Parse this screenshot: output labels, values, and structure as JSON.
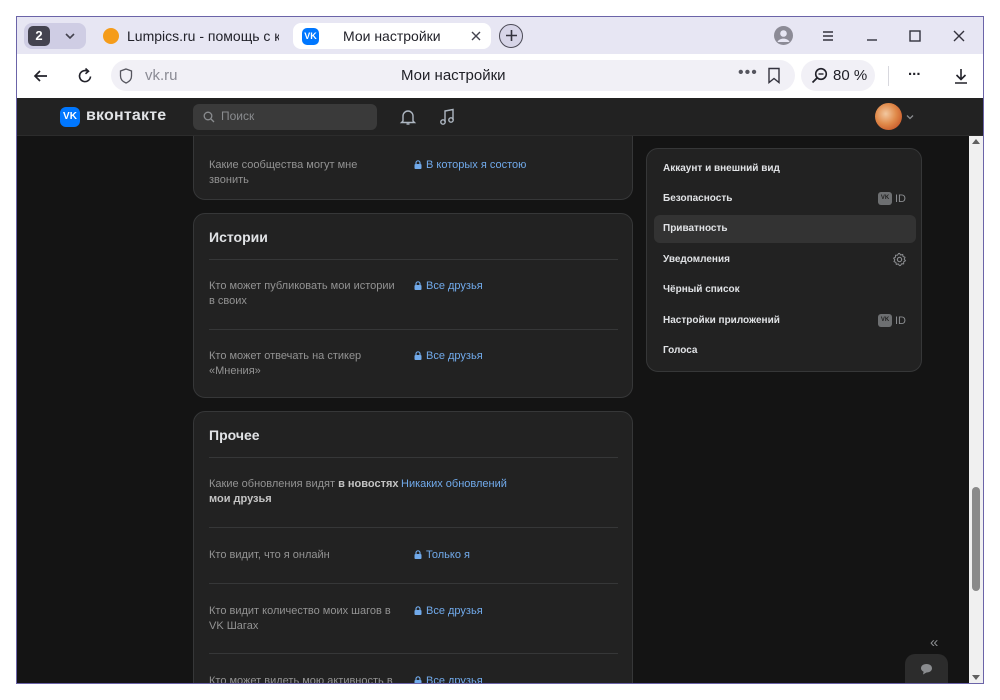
{
  "browser": {
    "tab_count": "2",
    "tabs": [
      {
        "label": "Lumpics.ru - помощь с ком"
      },
      {
        "label": "Мои настройки",
        "favicon": "VK"
      }
    ],
    "url": "vk.ru",
    "page_title": "Мои настройки",
    "zoom": "80 %",
    "more_label": "..."
  },
  "vk": {
    "logo_badge": "VK",
    "logo_text": "вконтакте",
    "search_placeholder": "Поиск"
  },
  "settings": {
    "top_row": {
      "label": "Какие сообщества могут мне звонить",
      "value": "В которых я состою"
    },
    "sections": [
      {
        "title": "Истории",
        "rows": [
          {
            "label": "Кто может публиковать мои истории в своих",
            "value": "Все друзья"
          },
          {
            "label": "Кто может отвечать на стикер «Мнения»",
            "value": "Все друзья"
          }
        ]
      },
      {
        "title": "Прочее",
        "rows": [
          {
            "label_plain": "Какие обновления видят ",
            "label_bold": "в новостях мои друзья",
            "value": "Никаких обновлений"
          },
          {
            "label": "Кто видит, что я онлайн",
            "value": "Только я"
          },
          {
            "label": "Кто видит количество моих шагов в VK Шагах",
            "value": "Все друзья"
          },
          {
            "label": "Кто может видеть мою активность в",
            "value": "Все друзья"
          }
        ]
      }
    ]
  },
  "menu": {
    "items": [
      {
        "label": "Аккаунт и внешний вид"
      },
      {
        "label": "Безопасность",
        "badge_box": "VK",
        "badge_text": "ID"
      },
      {
        "label": "Приватность"
      },
      {
        "label": "Уведомления"
      },
      {
        "label": "Чёрный список"
      },
      {
        "label": "Настройки приложений",
        "badge_box": "VK",
        "badge_text": "ID"
      },
      {
        "label": "Голоса"
      }
    ]
  },
  "colors": {
    "link": "#71aaeb",
    "card_bg": "#222222",
    "page_bg": "#141414",
    "vk_blue": "#0077ff"
  },
  "icons": [
    "tab-group-chevron-icon",
    "close-icon",
    "plus-icon",
    "back-icon",
    "reload-icon",
    "shield-icon",
    "bookmark-icon",
    "zoom-icon",
    "download-icon",
    "search-icon",
    "bell-icon",
    "music-icon",
    "lock-icon",
    "gear-icon",
    "chat-icon"
  ]
}
